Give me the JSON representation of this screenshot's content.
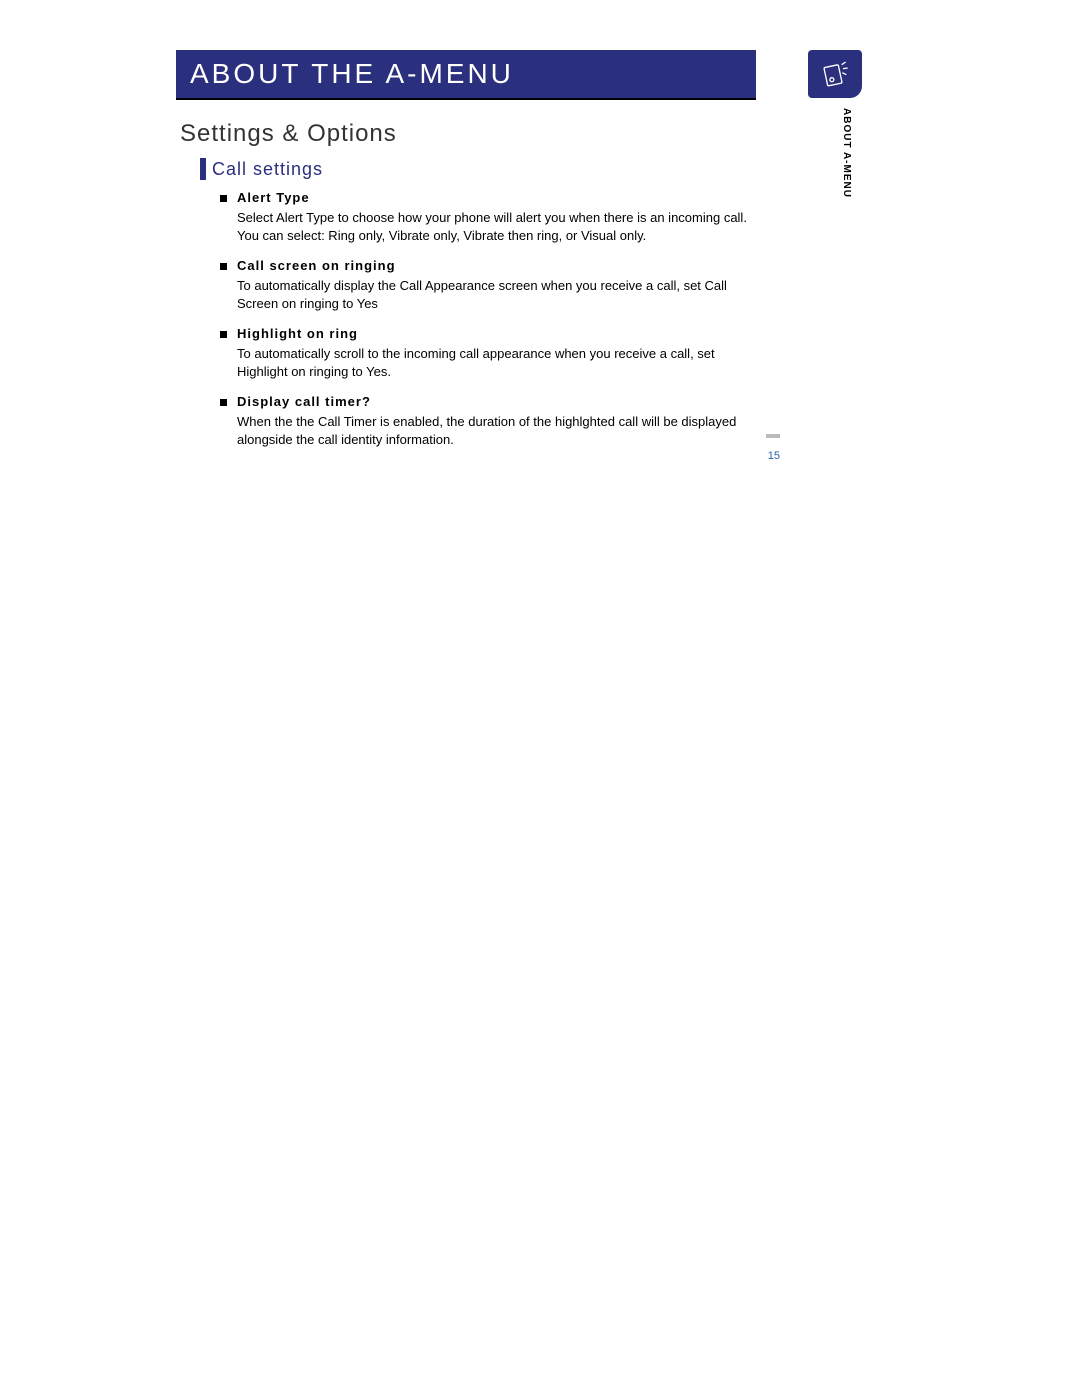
{
  "header": {
    "title": "ABOUT THE A-MENU"
  },
  "side": {
    "label": "ABOUT A-MENU"
  },
  "section": {
    "title": "Settings & Options"
  },
  "subsection": {
    "title": "Call settings"
  },
  "items": [
    {
      "title": "Alert Type",
      "body": "Select Alert Type to choose how your phone will alert you when there is an incoming call. You can select:   Ring only, Vibrate only, Vibrate then ring, or Visual only."
    },
    {
      "title": "Call screen on ringing",
      "body": "To automatically display the Call Appearance screen when you receive a call, set Call Screen on ringing to Yes"
    },
    {
      "title": "Highlight on ring",
      "body": "To automatically scroll to the incoming call appearance when you receive a call, set Highlight on ringing to Yes."
    },
    {
      "title": "Display call timer?",
      "body": "When the the Call Timer is enabled, the duration of the highlghted call will be displayed alongside the call identity information."
    }
  ],
  "page_number": "15"
}
